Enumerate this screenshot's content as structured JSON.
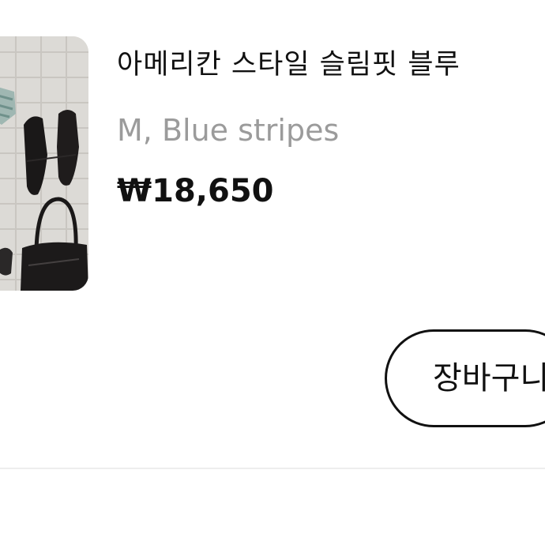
{
  "product": {
    "title": "아메리칸 스타일 슬림핏 블루",
    "option": "M, Blue stripes",
    "price": "₩18,650",
    "thumbnail_icon": "product-photo"
  },
  "actions": {
    "cart_label": "장바구니"
  }
}
